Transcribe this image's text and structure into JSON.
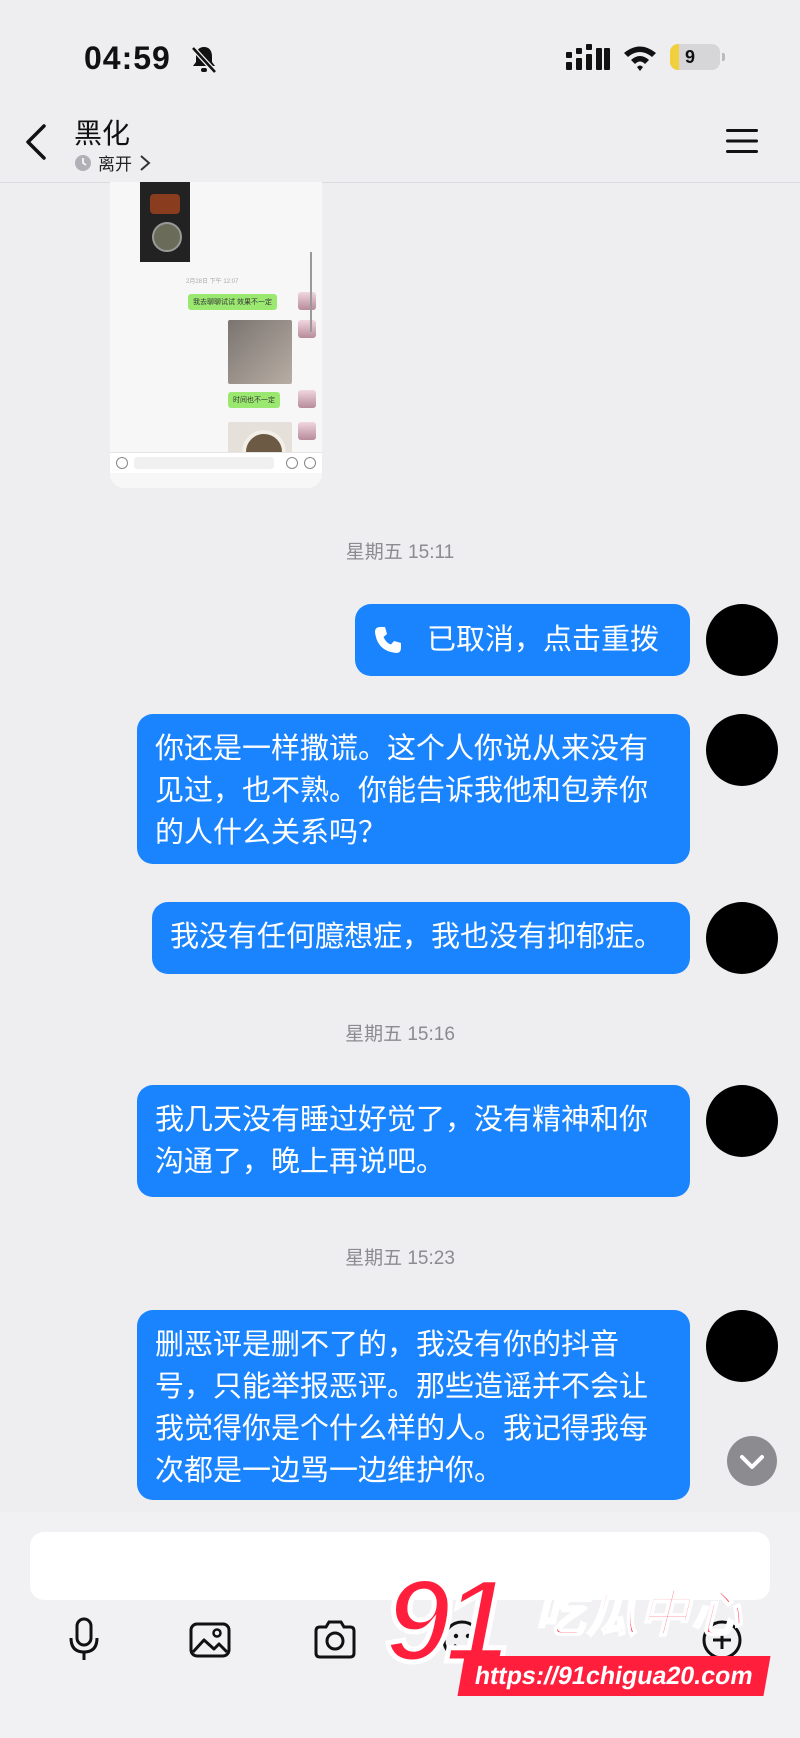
{
  "status_bar": {
    "time": "04:59",
    "battery": "9"
  },
  "header": {
    "title": "黑化",
    "status": "离开"
  },
  "preview": {
    "date": "2月28日 下午 12:07",
    "bubble1": "我去聊聊试试 效果不一定",
    "bubble2": "时间也不一定"
  },
  "messages": [
    {
      "timestamp": "星期五 15:11"
    },
    {
      "call_text": "已取消，点击重拨"
    },
    {
      "text": "你还是一样撒谎。这个人你说从来没有见过，也不熟。你能告诉我他和包养你的人什么关系吗？"
    },
    {
      "text": "我没有任何臆想症，我也没有抑郁症。"
    },
    {
      "timestamp": "星期五 15:16"
    },
    {
      "text": "我几天没有睡过好觉了，没有精神和你沟通了，晚上再说吧。"
    },
    {
      "timestamp": "星期五 15:23"
    },
    {
      "text": "删恶评是删不了的，我没有你的抖音号，只能举报恶评。那些造谣并不会让我觉得你是个什么样的人。我记得我每次都是一边骂一边维护你。"
    }
  ],
  "toolbar": {
    "icons": [
      "microphone-icon",
      "image-icon",
      "camera-icon",
      "emoji-icon",
      "add-icon"
    ]
  },
  "watermark": {
    "number": "91",
    "name": "吃瓜中心",
    "url": "https://91chigua20.com"
  },
  "colors": {
    "bubble": "#1a84ff",
    "background": "#eeeef1",
    "watermark": "#ff1f3d"
  }
}
